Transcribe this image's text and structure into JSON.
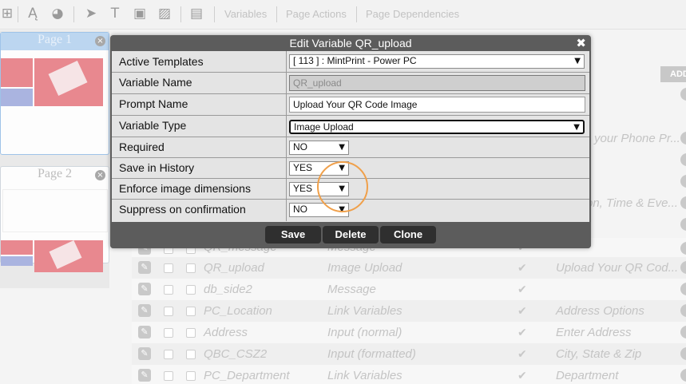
{
  "toolbar": {
    "variables": "Variables",
    "page_actions": "Page Actions",
    "page_dependencies": "Page Dependencies"
  },
  "pages": [
    {
      "title": "Page 1"
    },
    {
      "title": "Page 2"
    }
  ],
  "table": {
    "add_label": "ADD",
    "rows": [
      {
        "name": "QR_message",
        "type": "Message",
        "check": true,
        "prompt": ""
      },
      {
        "name": "QR_upload",
        "type": "Image Upload",
        "check": true,
        "prompt": "Upload Your QR Cod..."
      },
      {
        "name": "db_side2",
        "type": "Message",
        "check": true,
        "prompt": ""
      },
      {
        "name": "PC_Location",
        "type": "Link Variables",
        "check": true,
        "prompt": "Address Options"
      },
      {
        "name": "Address",
        "type": "Input (normal)",
        "check": true,
        "prompt": "Enter Address"
      },
      {
        "name": "QBC_CSZ2",
        "type": "Input (formatted)",
        "check": true,
        "prompt": "City, State & Zip"
      },
      {
        "name": "PC_Department",
        "type": "Link Variables",
        "check": true,
        "prompt": "Department"
      }
    ],
    "side_prompts": [
      "your Phone Pr...",
      "on, Time & Eve..."
    ]
  },
  "modal": {
    "title": "Edit Variable QR_upload",
    "fields": {
      "active_templates": {
        "label": "Active Templates",
        "value": "[ 113  ] : MintPrint - Power PC"
      },
      "variable_name": {
        "label": "Variable Name",
        "value": "QR_upload"
      },
      "prompt_name": {
        "label": "Prompt Name",
        "value": "Upload Your QR Code Image"
      },
      "variable_type": {
        "label": "Variable Type",
        "value": "Image Upload"
      },
      "required": {
        "label": "Required",
        "value": "NO"
      },
      "save_in_history": {
        "label": "Save in History",
        "value": "YES"
      },
      "enforce_image_dimensions": {
        "label": "Enforce image dimensions",
        "value": "YES"
      },
      "suppress_on_confirmation": {
        "label": "Suppress on confirmation",
        "value": "NO"
      }
    },
    "buttons": {
      "save": "Save",
      "delete": "Delete",
      "clone": "Clone"
    }
  },
  "colors": {
    "modal_header": "#5c5c5c",
    "button": "#2f2f2f",
    "highlight_circle": "#f0a04a"
  }
}
